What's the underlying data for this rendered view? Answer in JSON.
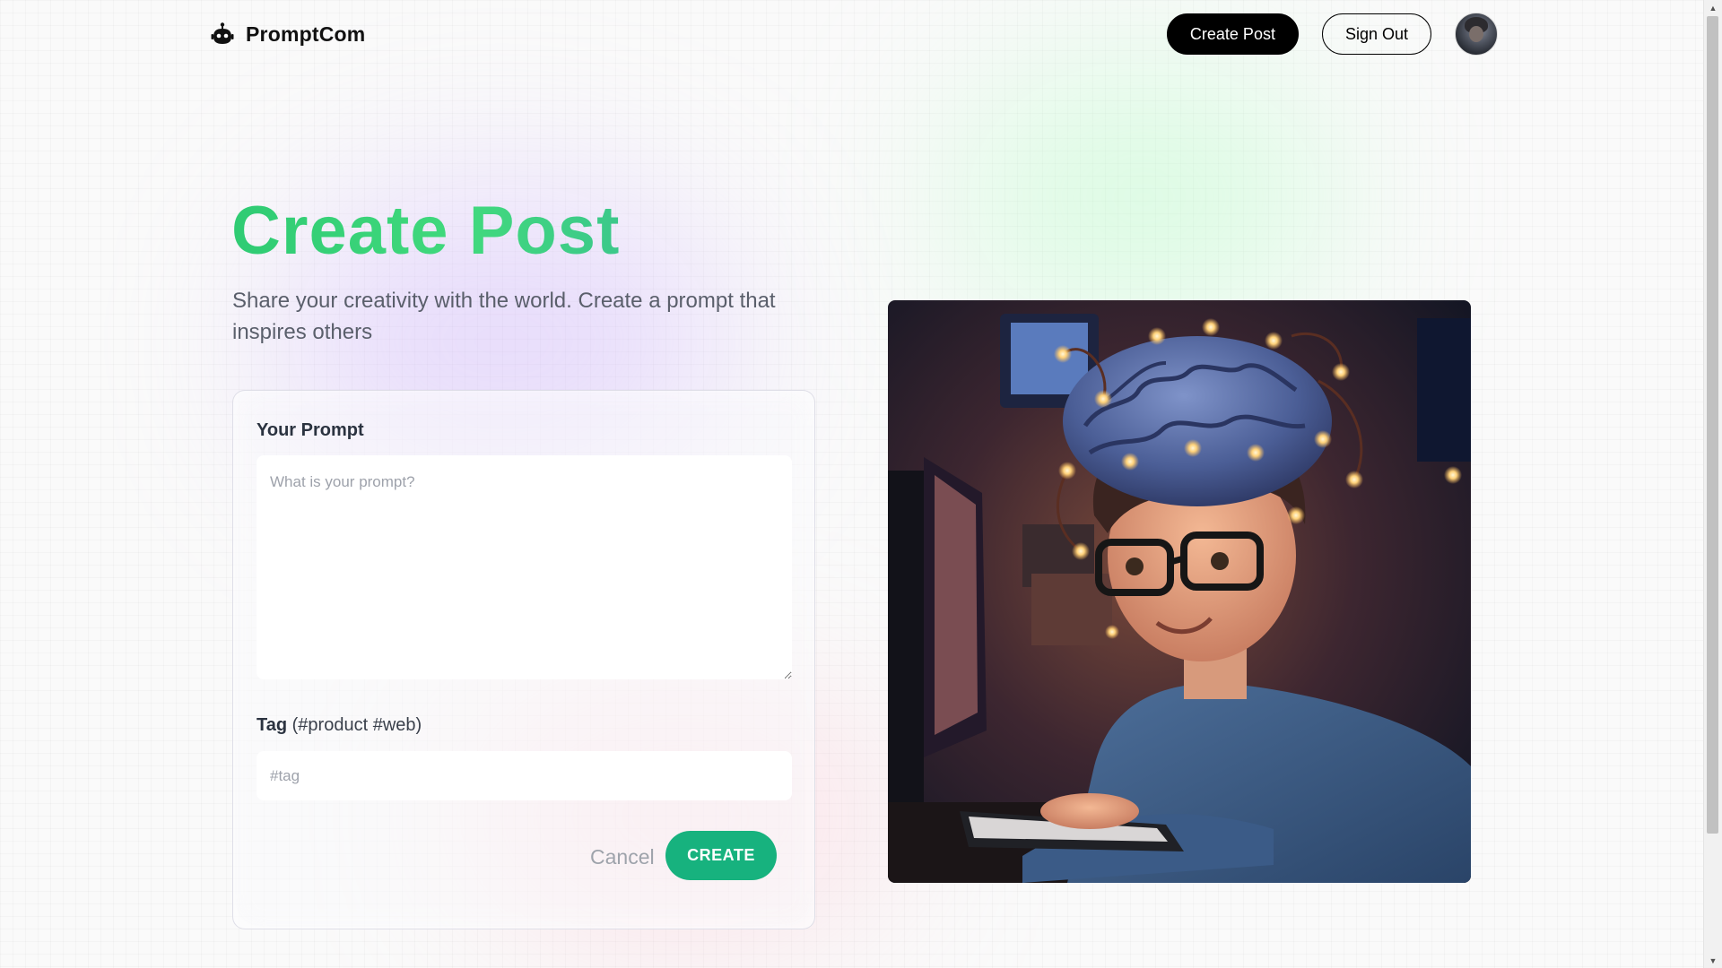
{
  "navbar": {
    "brand_name": "PromptCom",
    "logo_icon": "robot-icon",
    "create_post_label": "Create Post",
    "sign_out_label": "Sign Out"
  },
  "hero": {
    "title": "Create Post",
    "subtitle": "Share your creativity with the world. Create a prompt that inspires others"
  },
  "form": {
    "prompt_label": "Your Prompt",
    "prompt_placeholder": "What is your prompt?",
    "prompt_value": "",
    "tag_label": "Tag",
    "tag_hint": "(#product #web)",
    "tag_placeholder": "#tag",
    "tag_value": "",
    "cancel_label": "Cancel",
    "create_label": "CREATE"
  },
  "colors": {
    "title_green": "#2fcb73",
    "create_button": "#17b27e",
    "nav_button": "#000000"
  }
}
